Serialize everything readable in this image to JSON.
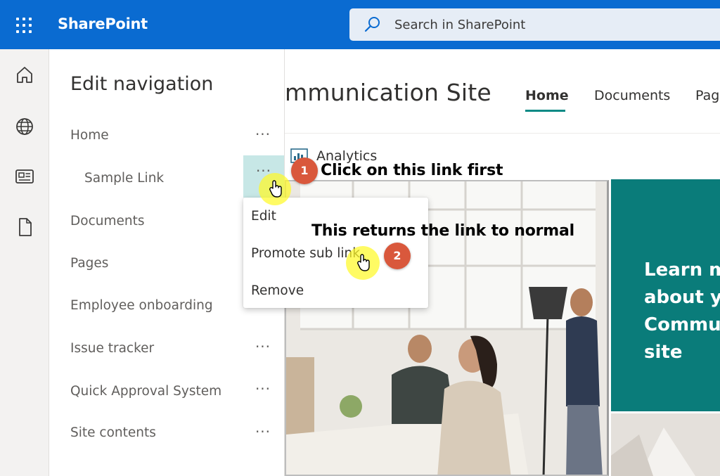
{
  "topbar": {
    "app_name": "SharePoint",
    "search_placeholder": "Search in SharePoint"
  },
  "rail": {
    "items": [
      "home-icon",
      "globe-icon",
      "news-icon",
      "document-icon"
    ]
  },
  "site": {
    "title_visible": "mmunication Site",
    "nav": [
      "Home",
      "Documents",
      "Page"
    ],
    "active_nav": "Home",
    "webpart_title": "Analytics",
    "promo_text": "Learn more about your Communication site"
  },
  "panel": {
    "title": "Edit navigation",
    "items": [
      {
        "label": "Home",
        "indent": false,
        "menu": true
      },
      {
        "label": "Sample Link",
        "indent": true,
        "menu": true,
        "active": true
      },
      {
        "label": "Documents",
        "indent": false,
        "menu": false
      },
      {
        "label": "Pages",
        "indent": false,
        "menu": false
      },
      {
        "label": "Employee onboarding",
        "indent": false,
        "menu": false
      },
      {
        "label": "Issue tracker",
        "indent": false,
        "menu": true
      },
      {
        "label": "Quick Approval System",
        "indent": false,
        "menu": true
      },
      {
        "label": "Site contents",
        "indent": false,
        "menu": true
      }
    ],
    "more_glyph": "···"
  },
  "context_menu": {
    "items": [
      "Edit",
      "Promote sub link",
      "Remove"
    ]
  },
  "annotations": {
    "step1": {
      "number": "1",
      "text": "Click on this link first"
    },
    "step2": {
      "number": "2",
      "text": "This returns the link to normal"
    }
  },
  "colors": {
    "suite_bar": "#0a6bd1",
    "search_bg": "#e6edf6",
    "accent_teal": "#0b8a85",
    "promo_bg": "#0a7c7a",
    "active_more_bg": "#c7e7e6",
    "step_badge": "#d9583c",
    "highlight": "#fffa28"
  }
}
